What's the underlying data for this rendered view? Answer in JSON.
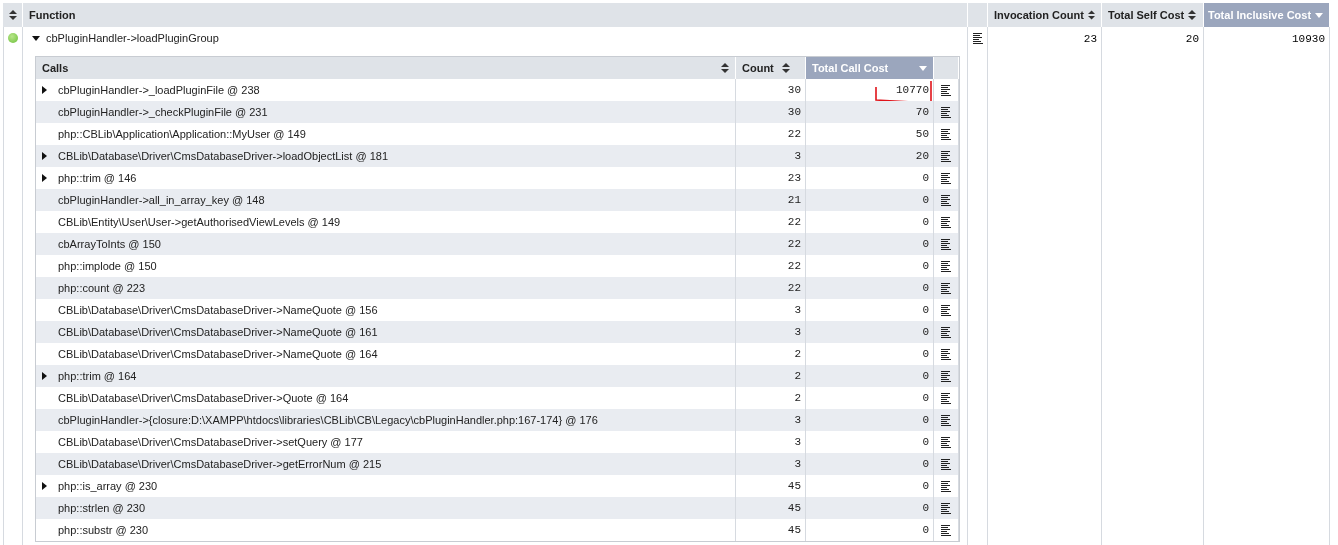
{
  "columns": [
    {
      "label": "Function",
      "selected": false
    },
    {
      "label": "Invocation Count",
      "sorted_descending": false,
      "selected": false
    },
    {
      "label": "Total Self Cost",
      "sorted_descending": false,
      "selected": false
    },
    {
      "label": "Total Inclusive Cost",
      "sorted_descending": true,
      "selected": true
    }
  ],
  "function": {
    "name": "cbPluginHandler->loadPluginGroup",
    "expanded": true,
    "invocation_count": "23",
    "total_self_cost": "20",
    "total_inclusive_cost": "10930"
  },
  "calls_columns": [
    {
      "label": "Calls",
      "sorted_descending": false,
      "selected": false
    },
    {
      "label": "Count",
      "sorted_descending": false,
      "selected": false
    },
    {
      "label": "Total Call Cost",
      "sorted_descending": true,
      "selected": true
    }
  ],
  "calls": [
    {
      "name": "cbPluginHandler->_loadPluginFile @ 238",
      "expandable": true,
      "count": "30",
      "cost": "10770",
      "annotated": true
    },
    {
      "name": "cbPluginHandler->_checkPluginFile @ 231",
      "expandable": false,
      "count": "30",
      "cost": "70",
      "annotated": false
    },
    {
      "name": "php::CBLib\\Application\\Application::MyUser @ 149",
      "expandable": false,
      "count": "22",
      "cost": "50",
      "annotated": false
    },
    {
      "name": "CBLib\\Database\\Driver\\CmsDatabaseDriver->loadObjectList @ 181",
      "expandable": true,
      "count": "3",
      "cost": "20",
      "annotated": false
    },
    {
      "name": "php::trim @ 146",
      "expandable": true,
      "count": "23",
      "cost": "0",
      "annotated": false
    },
    {
      "name": "cbPluginHandler->all_in_array_key @ 148",
      "expandable": false,
      "count": "21",
      "cost": "0",
      "annotated": false
    },
    {
      "name": "CBLib\\Entity\\User\\User->getAuthorisedViewLevels @ 149",
      "expandable": false,
      "count": "22",
      "cost": "0",
      "annotated": false
    },
    {
      "name": "cbArrayToInts @ 150",
      "expandable": false,
      "count": "22",
      "cost": "0",
      "annotated": false
    },
    {
      "name": "php::implode @ 150",
      "expandable": false,
      "count": "22",
      "cost": "0",
      "annotated": false
    },
    {
      "name": "php::count @ 223",
      "expandable": false,
      "count": "22",
      "cost": "0",
      "annotated": false
    },
    {
      "name": "CBLib\\Database\\Driver\\CmsDatabaseDriver->NameQuote @ 156",
      "expandable": false,
      "count": "3",
      "cost": "0",
      "annotated": false
    },
    {
      "name": "CBLib\\Database\\Driver\\CmsDatabaseDriver->NameQuote @ 161",
      "expandable": false,
      "count": "3",
      "cost": "0",
      "annotated": false
    },
    {
      "name": "CBLib\\Database\\Driver\\CmsDatabaseDriver->NameQuote @ 164",
      "expandable": false,
      "count": "2",
      "cost": "0",
      "annotated": false
    },
    {
      "name": "php::trim @ 164",
      "expandable": true,
      "count": "2",
      "cost": "0",
      "annotated": false
    },
    {
      "name": "CBLib\\Database\\Driver\\CmsDatabaseDriver->Quote @ 164",
      "expandable": false,
      "count": "2",
      "cost": "0",
      "annotated": false
    },
    {
      "name": "cbPluginHandler->{closure:D:\\XAMPP\\htdocs\\libraries\\CBLib\\CB\\Legacy\\cbPluginHandler.php:167-174} @ 176",
      "expandable": false,
      "count": "3",
      "cost": "0",
      "annotated": false
    },
    {
      "name": "CBLib\\Database\\Driver\\CmsDatabaseDriver->setQuery @ 177",
      "expandable": false,
      "count": "3",
      "cost": "0",
      "annotated": false
    },
    {
      "name": "CBLib\\Database\\Driver\\CmsDatabaseDriver->getErrorNum @ 215",
      "expandable": false,
      "count": "3",
      "cost": "0",
      "annotated": false
    },
    {
      "name": "php::is_array @ 230",
      "expandable": true,
      "count": "45",
      "cost": "0",
      "annotated": false
    },
    {
      "name": "php::strlen @ 230",
      "expandable": false,
      "count": "45",
      "cost": "0",
      "annotated": false
    },
    {
      "name": "php::substr @ 230",
      "expandable": false,
      "count": "45",
      "cost": "0",
      "annotated": false
    }
  ]
}
